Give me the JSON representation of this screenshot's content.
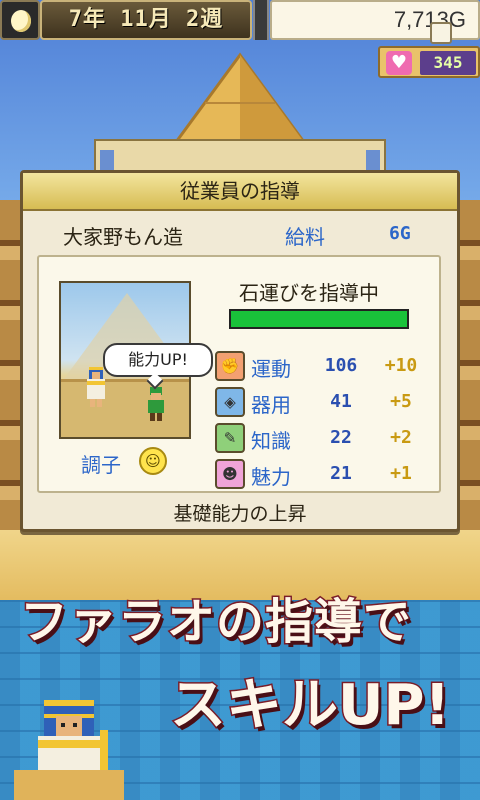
{
  "topbar": {
    "date": "7年 11月 2週",
    "money": "7,713G",
    "hearts": "345"
  },
  "panel": {
    "title": "従業員の指導",
    "employee_name": "大家野もん造",
    "salary_label": "給料",
    "salary_value": "6G",
    "bubble": "能力UP!",
    "condition_label": "調子",
    "task": "石運びを指導中",
    "progress": 1.0,
    "footer": "基礎能力の上昇",
    "stats": [
      {
        "label": "運動",
        "value": "106",
        "increase": "+10",
        "icon": "sports-icon",
        "color": "#f3a071"
      },
      {
        "label": "器用",
        "value": "41",
        "increase": "+5",
        "icon": "dexterity-icon",
        "color": "#7fb7e8"
      },
      {
        "label": "知識",
        "value": "22",
        "increase": "+2",
        "icon": "knowledge-icon",
        "color": "#8fd07a"
      },
      {
        "label": "魅力",
        "value": "21",
        "increase": "+1",
        "icon": "charm-icon",
        "color": "#f0a4d8"
      }
    ]
  },
  "promo": {
    "line1": "ファラオの指導で",
    "line2": "スキルUP!"
  },
  "colors": {
    "accent_blue": "#2c66c9",
    "gold": "#c99a12",
    "progress_green": "#19c23a"
  }
}
